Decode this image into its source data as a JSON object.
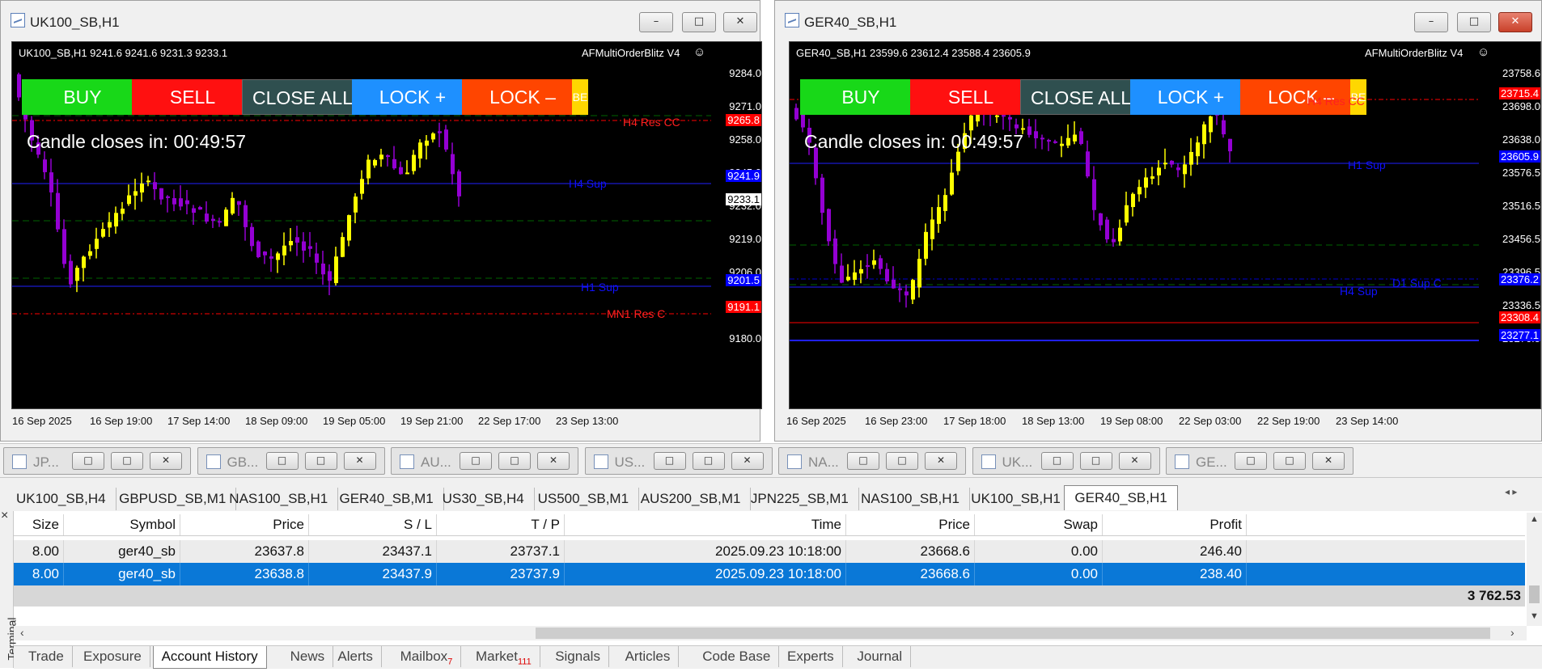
{
  "windows": [
    {
      "title": "UK100_SB,H1",
      "header": "UK100_SB,H1  9241.6 9241.6 9231.3 9233.1",
      "ea": "AFMultiOrderBlitz V4",
      "candle_closes": "Candle closes in: 00:49:57",
      "price_labels": [
        "9284.0",
        "9271.0",
        "9258.0",
        "9245.0",
        "9232.0",
        "9219.0",
        "9206.0",
        "9193.0",
        "9180.0"
      ],
      "price_tags": [
        {
          "text": "9265.8",
          "bg": "#ff0000"
        },
        {
          "text": "9241.9",
          "bg": "#0000ff"
        },
        {
          "text": "9233.1",
          "bg": "#ffffff"
        },
        {
          "text": "9201.5",
          "bg": "#0000ff"
        },
        {
          "text": "9191.1",
          "bg": "#ff0000"
        }
      ],
      "line_labels": [
        {
          "text": "H4 Res CC",
          "color": "#ff2020"
        },
        {
          "text": "H4 Sup",
          "color": "#1010ff"
        },
        {
          "text": "H1 Sup",
          "color": "#1010ff"
        },
        {
          "text": "MN1 Res C",
          "color": "#ff2020"
        }
      ],
      "time_labels": [
        "16 Sep 2025",
        "16 Sep 19:00",
        "17 Sep 14:00",
        "18 Sep 09:00",
        "19 Sep 05:00",
        "19 Sep 21:00",
        "22 Sep 17:00",
        "23 Sep 13:00"
      ]
    },
    {
      "title": "GER40_SB,H1",
      "header": "GER40_SB,H1  23599.6 23612.4 23588.4 23605.9",
      "ea": "AFMultiOrderBlitz V4",
      "candle_closes": "Candle closes in: 00:49:57",
      "price_labels": [
        "23758.6",
        "23698.0",
        "23638.0",
        "23576.5",
        "23516.5",
        "23456.5",
        "23396.5",
        "23336.5",
        "23276.5"
      ],
      "price_tags": [
        {
          "text": "23715.4",
          "bg": "#ff0000"
        },
        {
          "text": "23605.9",
          "bg": "#0000ff"
        },
        {
          "text": "23376.2",
          "bg": "#0000ff"
        },
        {
          "text": "23308.4",
          "bg": "#ff0000"
        },
        {
          "text": "23277.1",
          "bg": "#0000ff"
        }
      ],
      "line_labels": [
        {
          "text": "H4 Res CC",
          "color": "#ff2020"
        },
        {
          "text": "H1 Sup",
          "color": "#1010ff"
        },
        {
          "text": "D1 Sup C",
          "color": "#1010ff"
        },
        {
          "text": "H4 Sup",
          "color": "#1010ff"
        }
      ],
      "time_labels": [
        "16 Sep 2025",
        "16 Sep 23:00",
        "17 Sep 18:00",
        "18 Sep 13:00",
        "19 Sep 08:00",
        "22 Sep 03:00",
        "22 Sep 19:00",
        "23 Sep 14:00"
      ]
    }
  ],
  "trade_buttons": [
    {
      "label": "BUY",
      "bg": "#18d818"
    },
    {
      "label": "SELL",
      "bg": "#ff1010"
    },
    {
      "label": "CLOSE ALL",
      "bg": "#2f4f4f"
    },
    {
      "label": "LOCK +",
      "bg": "#1e90ff"
    },
    {
      "label": "LOCK –",
      "bg": "#ff4500"
    },
    {
      "label": "BE",
      "bg": "#ffd700"
    }
  ],
  "window_buttons": {
    "minimize": "–",
    "maximize": "□",
    "close": "✕"
  },
  "mdi_tabs": [
    "JP...",
    "GB...",
    "AU...",
    "US...",
    "NA...",
    "UK...",
    "GE..."
  ],
  "chart_tabs": [
    "UK100_SB,H4",
    "GBPUSD_SB,M1",
    "NAS100_SB,H1",
    "GER40_SB,M1",
    "US30_SB,H4",
    "US500_SB,M1",
    "AUS200_SB,M1",
    "JPN225_SB,M1",
    "NAS100_SB,H1",
    "UK100_SB,H1",
    "GER40_SB,H1"
  ],
  "active_chart_tab": 10,
  "terminal": {
    "side_label": "Terminal",
    "close_glyph": "×",
    "columns": [
      "Size",
      "Symbol",
      "Price",
      "S / L",
      "T / P",
      "Time",
      "Price",
      "Swap",
      "Profit"
    ],
    "rows": [
      {
        "size": "8.00",
        "symbol": "ger40_sb",
        "price": "23637.8",
        "sl": "23437.1",
        "tp": "23737.1",
        "time": "2025.09.23 10:18:00",
        "close_price": "23668.6",
        "swap": "0.00",
        "profit": "246.40",
        "selected": false
      },
      {
        "size": "8.00",
        "symbol": "ger40_sb",
        "price": "23638.8",
        "sl": "23437.9",
        "tp": "23737.9",
        "time": "2025.09.23 10:18:00",
        "close_price": "23668.6",
        "swap": "0.00",
        "profit": "238.40",
        "selected": true
      }
    ],
    "total_profit": "3 762.53",
    "bottom_tabs": [
      {
        "label": "Trade",
        "badge": ""
      },
      {
        "label": "Exposure",
        "badge": ""
      },
      {
        "label": "Account History",
        "badge": ""
      },
      {
        "label": "News",
        "badge": ""
      },
      {
        "label": "Alerts",
        "badge": ""
      },
      {
        "label": "Mailbox",
        "badge": "7"
      },
      {
        "label": "Market",
        "badge": "111"
      },
      {
        "label": "Signals",
        "badge": ""
      },
      {
        "label": "Articles",
        "badge": ""
      },
      {
        "label": "Code Base",
        "badge": ""
      },
      {
        "label": "Experts",
        "badge": ""
      },
      {
        "label": "Journal",
        "badge": ""
      }
    ],
    "active_bottom_tab": 2
  }
}
